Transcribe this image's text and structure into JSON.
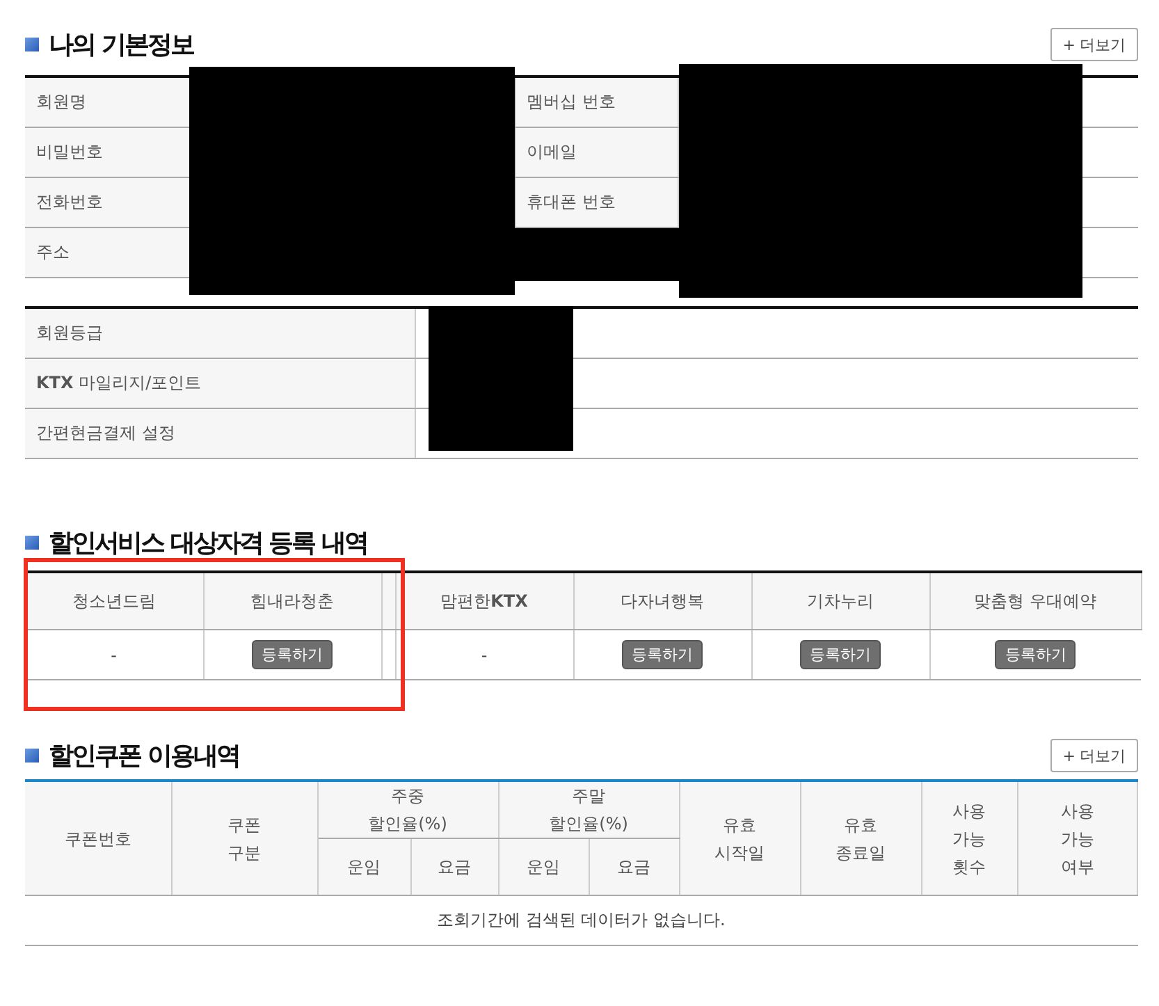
{
  "basic_info": {
    "title": "나의 기본정보",
    "more_button": {
      "icon": "+",
      "label": "더보기"
    },
    "rows": [
      {
        "label": "회원명",
        "label_2": "멤버십 번호"
      },
      {
        "label": "비밀번호",
        "label_2": "이메일"
      },
      {
        "label": "전화번호",
        "label_2": "휴대폰 번호"
      },
      {
        "label": "주소"
      }
    ],
    "extra_rows": [
      {
        "label": "회원등급"
      },
      {
        "label": "**KTX** 마일리지/포인트"
      },
      {
        "label": "간편현금결제 설정"
      }
    ]
  },
  "discount_service": {
    "title": "할인서비스 대상자격 등록 내역",
    "columns": [
      {
        "header": "청소년드림",
        "value": "-",
        "kind": "text"
      },
      {
        "header": "힘내라청춘",
        "value": "등록하기",
        "kind": "button"
      },
      {
        "kind": "spacer"
      },
      {
        "header": "맘편한**KTX**",
        "value": "-",
        "kind": "text"
      },
      {
        "header": "다자녀행복",
        "value": "등록하기",
        "kind": "button"
      },
      {
        "header": "기차누리",
        "value": "등록하기",
        "kind": "button"
      },
      {
        "header": "맞춤형 우대예약",
        "value": "등록하기",
        "kind": "button"
      }
    ]
  },
  "coupon_history": {
    "title": "할인쿠폰 이용내역",
    "more_button": {
      "icon": "+",
      "label": "더보기"
    },
    "columns": [
      "쿠폰번호",
      "쿠폰\n구분",
      "주중\n할인율(%)",
      "주말\n할인율(%)",
      "유효\n시작일",
      "유효\n종료일",
      "사용\n가능\n횟수",
      "사용\n가능\n여부"
    ],
    "sub_columns": [
      "운임",
      "요금",
      "운임",
      "요금"
    ],
    "empty_message": "조회기간에 검색된 데이터가 없습니다."
  }
}
